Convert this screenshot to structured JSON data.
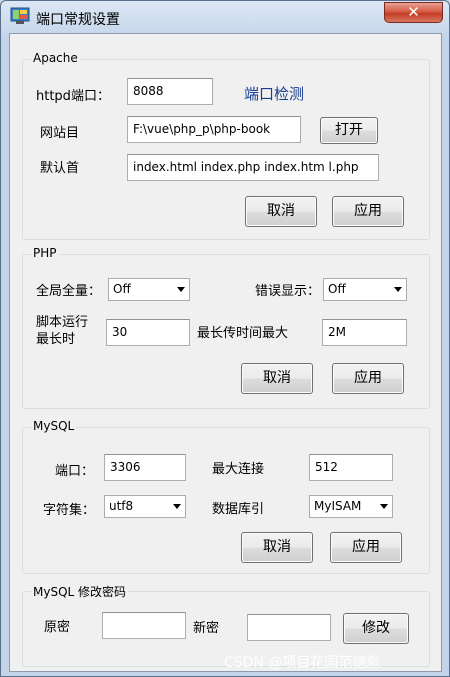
{
  "window": {
    "title": "端口常规设置",
    "close_label": "✕"
  },
  "apache": {
    "legend": "Apache",
    "httpd_port_label": "httpd端口：",
    "httpd_port_value": "8088",
    "check_port_link": "端口检测",
    "site_dir_label": "网站目",
    "site_dir_value": "F:\\vue\\php_p\\php-book",
    "open_button": "打开",
    "default_index_label": "默认首",
    "default_index_value": "index.html index.php index.htm l.php",
    "cancel_button": "取消",
    "apply_button": "应用"
  },
  "php": {
    "legend": "PHP",
    "global_var_label": "全局全量：",
    "global_var_value": "Off",
    "error_display_label": "错误显示：",
    "error_display_value": "Off",
    "max_exec_label_line1": "脚本运行",
    "max_exec_label_line2": "最长时",
    "max_exec_value": "30",
    "max_upload_label": "最长传时间最大",
    "max_upload_value": "2M",
    "cancel_button": "取消",
    "apply_button": "应用"
  },
  "mysql": {
    "legend": "MySQL",
    "port_label": "端口：",
    "port_value": "3306",
    "max_conn_label": "最大连接",
    "max_conn_value": "512",
    "charset_label": "字符集：",
    "charset_value": "utf8",
    "engine_label": "数据库引",
    "engine_value": "MyISAM",
    "cancel_button": "取消",
    "apply_button": "应用"
  },
  "password": {
    "legend": "MySQL 修改密码",
    "old_label": "原密",
    "old_value": "",
    "new_label": "新密",
    "new_value": "",
    "modify_button": "修改"
  },
  "watermark": "CSDN @项目花园范德彪"
}
